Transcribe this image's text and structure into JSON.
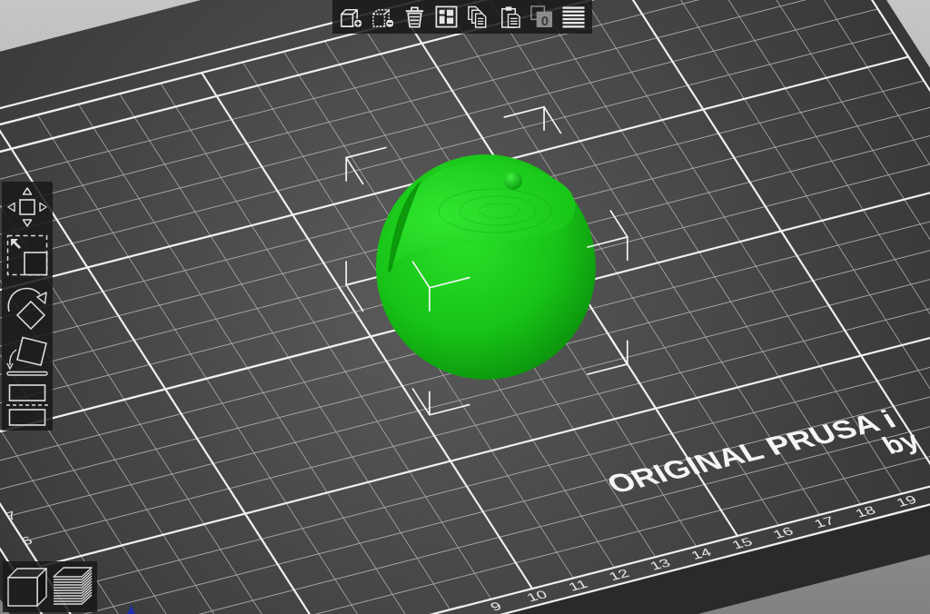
{
  "top_toolbar": {
    "buttons": [
      {
        "kind": "add",
        "disabled": false
      },
      {
        "kind": "delete",
        "disabled": false
      },
      {
        "kind": "delete_all",
        "disabled": false
      },
      {
        "kind": "arrange",
        "disabled": false
      },
      {
        "kind": "copy",
        "disabled": false
      },
      {
        "kind": "paste",
        "disabled": false
      },
      {
        "kind": "instances",
        "label": "0",
        "disabled": true
      },
      {
        "kind": "layers",
        "disabled": false
      }
    ]
  },
  "gizmo_toolbar": {
    "tools": [
      {
        "kind": "move"
      },
      {
        "kind": "scale"
      },
      {
        "kind": "rotate"
      },
      {
        "kind": "place_on_face"
      },
      {
        "kind": "cut"
      }
    ]
  },
  "model": {
    "selected": true
  },
  "bed": {
    "logo_lines": [
      "ORIGINAL PRUSA i",
      "by"
    ],
    "left_ruler": [
      "7",
      "6"
    ],
    "front_ruler": [
      "9",
      "10",
      "11",
      "12",
      "13",
      "14",
      "15",
      "16",
      "17",
      "18",
      "19"
    ]
  },
  "view_toolbar": {
    "views": [
      {
        "kind": "editor"
      },
      {
        "kind": "preview"
      }
    ]
  }
}
